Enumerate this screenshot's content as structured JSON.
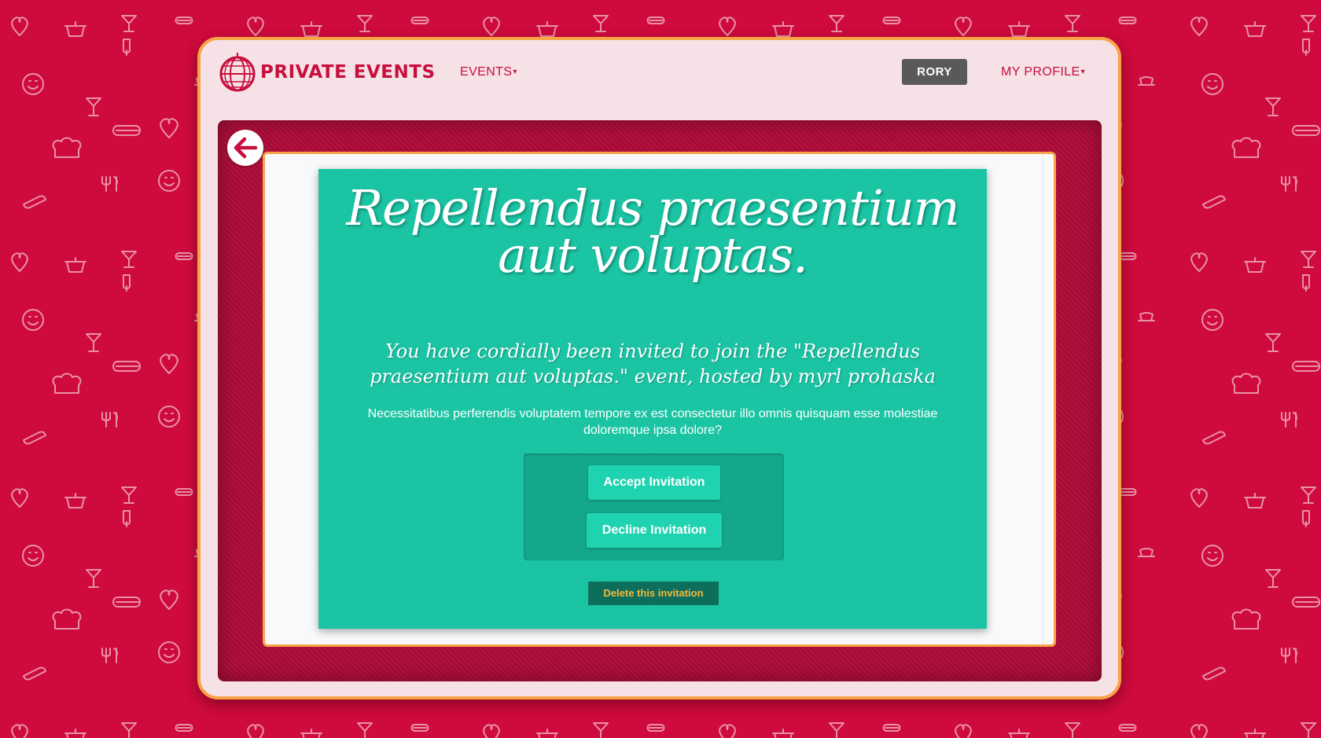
{
  "colors": {
    "background": "#cf0a3c",
    "frame_border": "#f8a348",
    "brand": "#c80e3c",
    "invite_card": "#1bc6a5",
    "delete_text": "#f6b93b"
  },
  "header": {
    "brand_icon": "disco-ball-icon",
    "brand_name": "PRIVATE EVENTS",
    "events_label": "EVENTS",
    "user_name": "RORY",
    "profile_label": "MY PROFILE"
  },
  "back_icon": "arrow-left-icon",
  "invitation": {
    "title": "Repellendus praesentium aut voluptas.",
    "message": "You have cordially been invited to join the \"Repellendus praesentium aut voluptas.\" event, hosted by myrl prohaska",
    "description": "Necessitatibus perferendis voluptatem tempore ex est consectetur illo omnis quisquam esse molestiae doloremque ipsa dolore?",
    "accept_label": "Accept Invitation",
    "decline_label": "Decline Invitation",
    "delete_label": "Delete this invitation"
  }
}
